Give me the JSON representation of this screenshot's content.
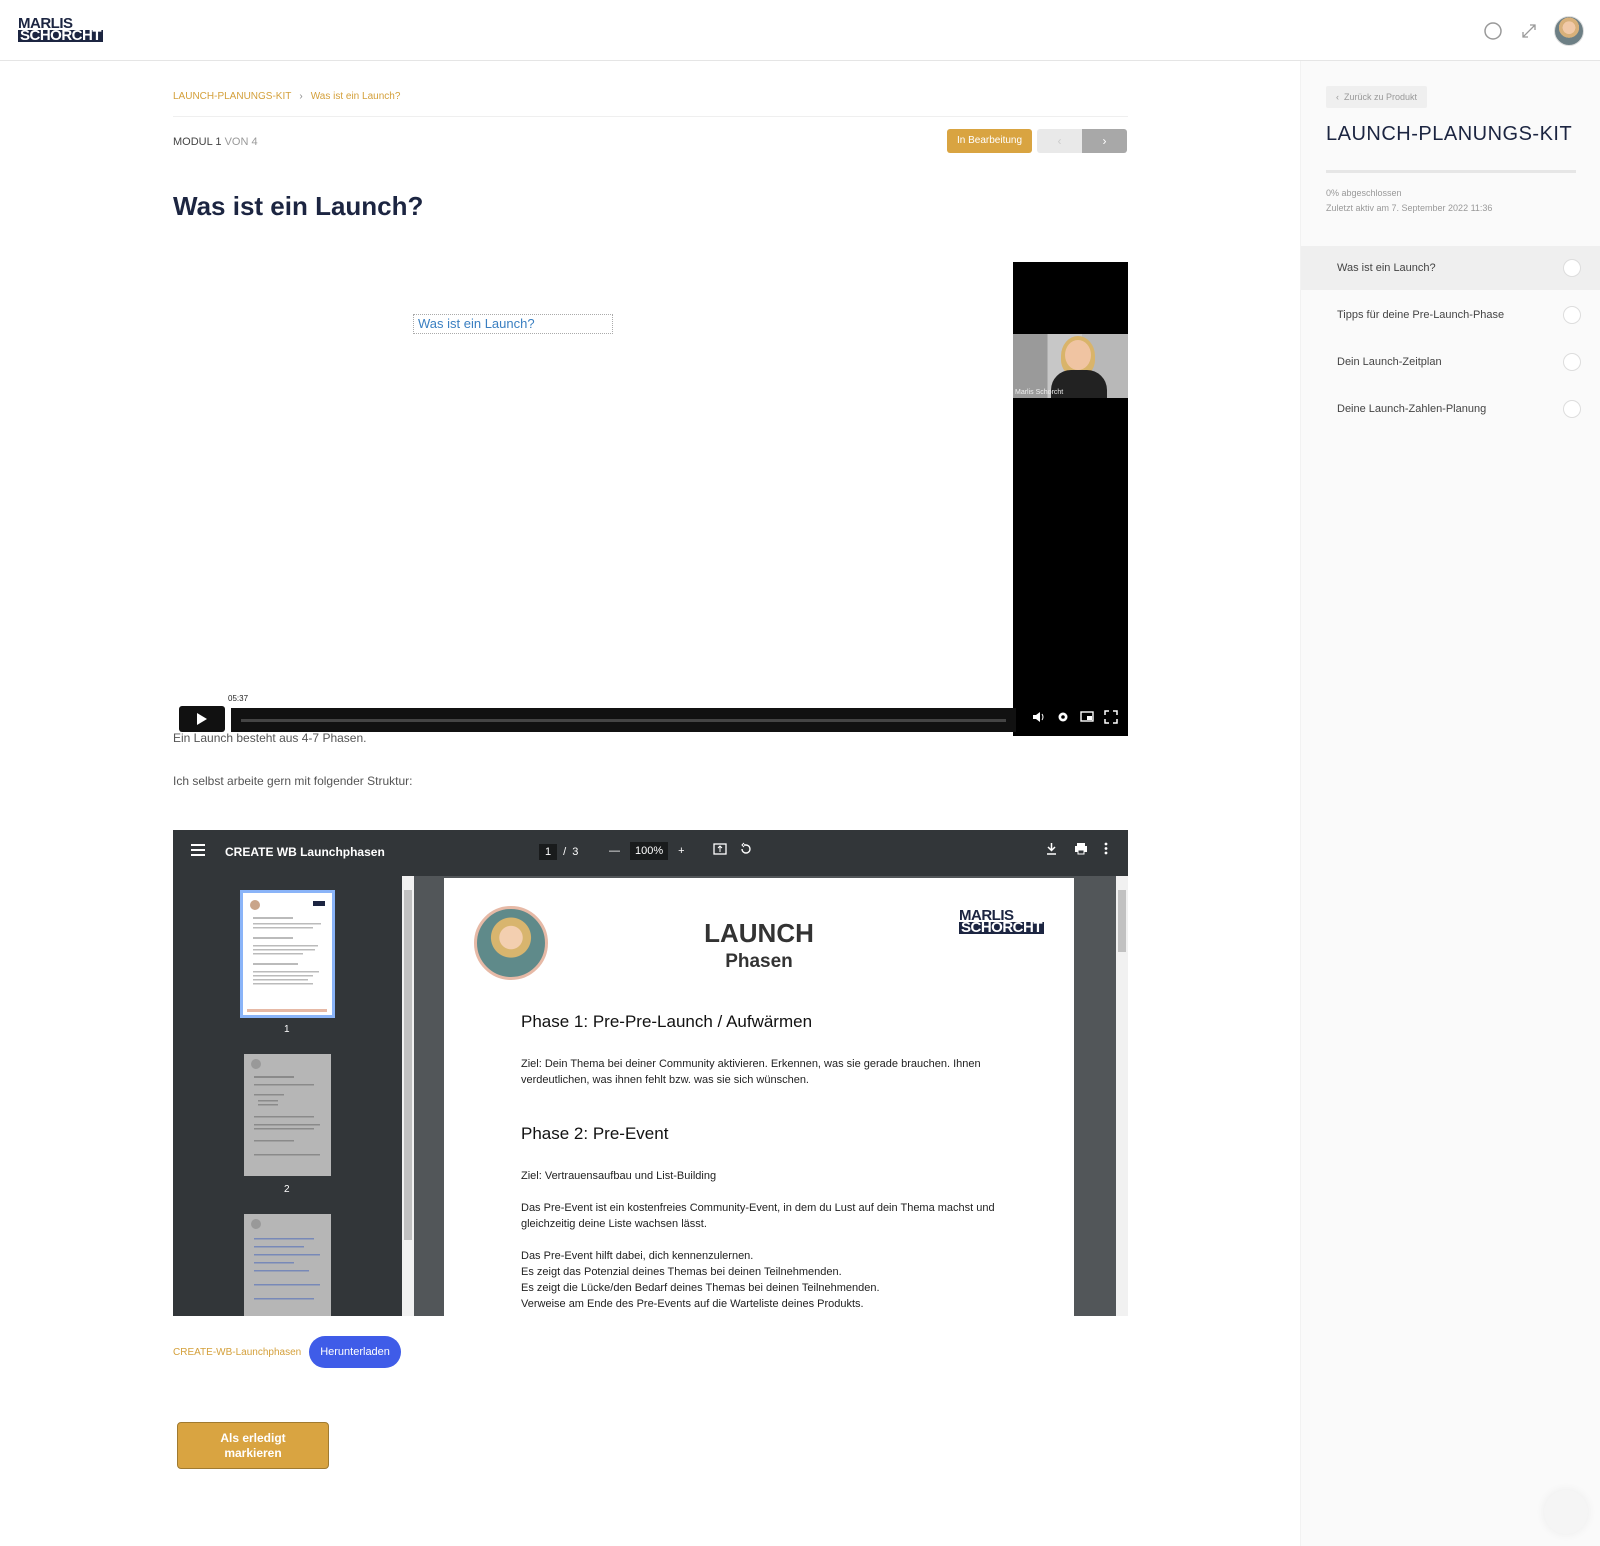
{
  "header": {
    "logo_line1": "MARLIS",
    "logo_line2": "SCHORCHT",
    "icons": [
      "moon-icon",
      "expand-icon",
      "user-avatar"
    ]
  },
  "breadcrumb": {
    "course": "LAUNCH-PLANUNGS-KIT",
    "separator": "›",
    "current": "Was ist ein Launch?"
  },
  "module": {
    "label": "MODUL",
    "number": "1",
    "of_text": "VON 4"
  },
  "status_button": "In Bearbeitung",
  "nav": {
    "prev": "‹",
    "next": "›"
  },
  "title": "Was ist ein Launch?",
  "video": {
    "caption": "Was ist ein Launch?",
    "speaker": "Marlis Schorcht",
    "time": "05:37"
  },
  "paragraphs": [
    "Ein Launch besteht aus 4-7 Phasen.",
    "Ich selbst arbeite gern mit folgender Struktur:"
  ],
  "pdf": {
    "title": "CREATE WB Launchphasen",
    "page_current": "1",
    "page_sep": "/",
    "page_total": "3",
    "zoom": "100%",
    "thumb_labels": [
      "1",
      "2"
    ],
    "page": {
      "h1": "LAUNCH",
      "h2": "Phasen",
      "logo_line1": "MARLIS",
      "logo_line2": "SCHORCHT",
      "phase1_title": "Phase 1: Pre-Pre-Launch / Aufwärmen",
      "phase1_text": "Ziel: Dein Thema bei deiner Community aktivieren. Erkennen, was sie gerade brauchen. Ihnen verdeutlichen, was ihnen fehlt bzw. was sie sich wünschen.",
      "phase2_title": "Phase 2: Pre-Event",
      "phase2_goal": "Ziel: Vertrauensaufbau und List-Building",
      "phase2_text1": "Das Pre-Event ist ein kostenfreies Community-Event, in dem du Lust auf dein Thema machst und gleichzeitig deine Liste wachsen lässt.",
      "phase2_lines": [
        "Das Pre-Event hilft dabei, dich kennenzulernen.",
        "Es zeigt das Potenzial deines Themas bei deinen Teilnehmenden.",
        "Es zeigt die Lücke/den Bedarf deines Themas bei deinen Teilnehmenden.",
        "Verweise am Ende des Pre-Events auf die Warteliste deines Produkts."
      ]
    }
  },
  "file": {
    "name": "CREATE-WB-Launchphasen",
    "download": "Herunterladen"
  },
  "mark_done": {
    "line1": "Als erledigt",
    "line2": "markieren"
  },
  "sidebar": {
    "back": "Zurück zu Produkt",
    "course_title": "LAUNCH-PLANUNGS-KIT",
    "progress_text": "0% abgeschlossen",
    "last_active": "Zuletzt aktiv am 7. September 2022 11:36",
    "progress_percent": 0,
    "lessons": [
      {
        "label": "Was ist ein Launch?",
        "active": true
      },
      {
        "label": "Tipps für deine Pre-Launch-Phase",
        "active": false
      },
      {
        "label": "Dein Launch-Zeitplan",
        "active": false
      },
      {
        "label": "Deine Launch-Zahlen-Planung",
        "active": false
      }
    ]
  },
  "colors": {
    "accent": "#d9a441",
    "navy": "#1c2541",
    "download_blue": "#3f5ce8"
  }
}
